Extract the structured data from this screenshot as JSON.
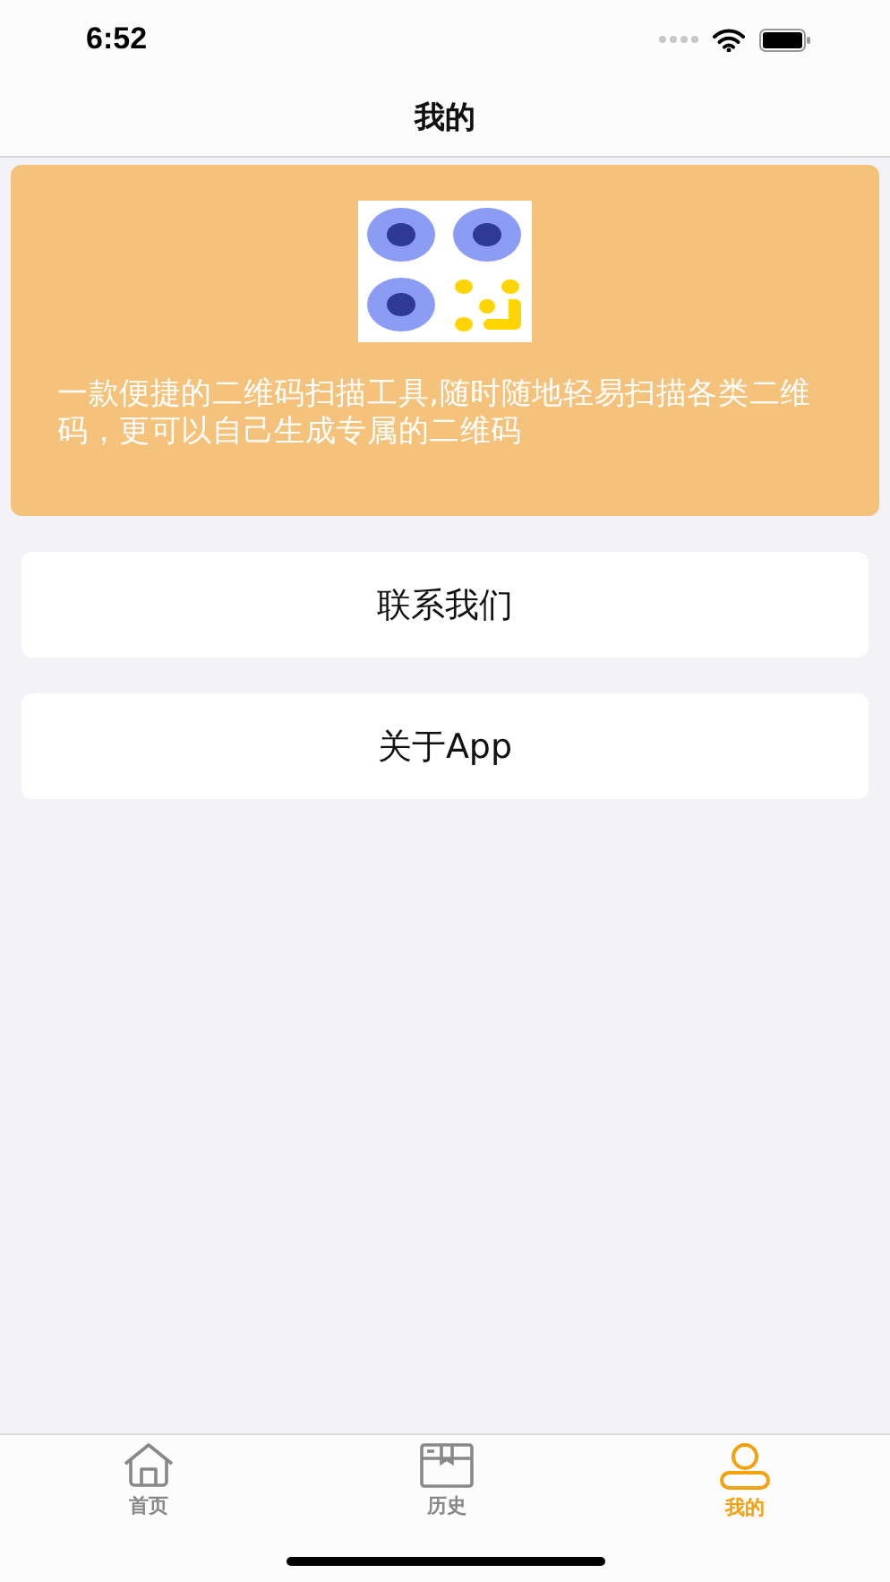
{
  "status_bar": {
    "time": "6:52"
  },
  "nav_bar": {
    "title": "我的"
  },
  "banner": {
    "description": "一款便捷的二维码扫描工具,随时随地轻易扫描各类二维码，更可以自己生成专属的二维码"
  },
  "menu": [
    {
      "label": "联系我们"
    },
    {
      "label": "关于App"
    }
  ],
  "tab_bar": [
    {
      "label": "首页",
      "kind": "home",
      "selected": false
    },
    {
      "label": "历史",
      "kind": "history",
      "selected": false
    },
    {
      "label": "我的",
      "kind": "profile",
      "selected": true
    }
  ]
}
